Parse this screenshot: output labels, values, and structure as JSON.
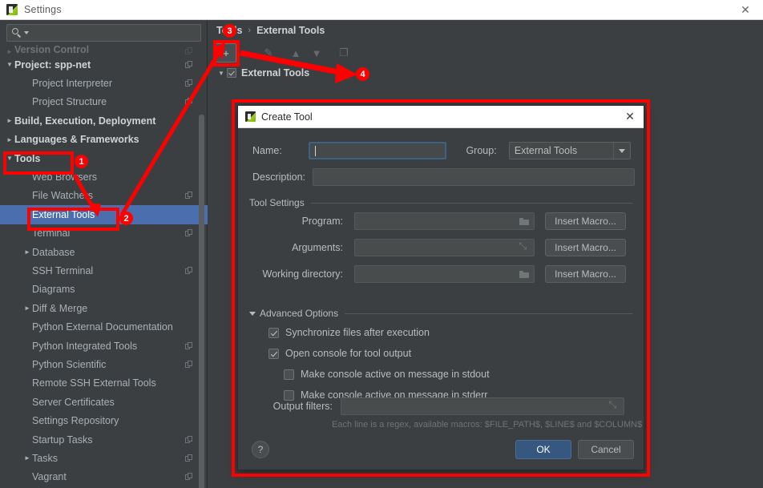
{
  "window": {
    "title": "Settings",
    "app_icon": "pycharm-icon",
    "close_label": "✕"
  },
  "search": {
    "value": "",
    "placeholder": "",
    "icon": "search-icon"
  },
  "sidebar": {
    "scrollbar": true,
    "items": [
      {
        "label": "Version Control",
        "indent": 0,
        "arrow": "right",
        "bold": true,
        "copy": true,
        "partial": true,
        "selected": false
      },
      {
        "label": "Project: spp-net",
        "indent": 0,
        "arrow": "down",
        "bold": true,
        "copy": true,
        "partial": false,
        "selected": false
      },
      {
        "label": "Project Interpreter",
        "indent": 1,
        "arrow": "",
        "bold": false,
        "copy": true,
        "partial": false,
        "selected": false
      },
      {
        "label": "Project Structure",
        "indent": 1,
        "arrow": "",
        "bold": false,
        "copy": true,
        "partial": false,
        "selected": false
      },
      {
        "label": "Build, Execution, Deployment",
        "indent": 0,
        "arrow": "right",
        "bold": true,
        "copy": false,
        "partial": false,
        "selected": false
      },
      {
        "label": "Languages & Frameworks",
        "indent": 0,
        "arrow": "right",
        "bold": true,
        "copy": false,
        "partial": false,
        "selected": false
      },
      {
        "label": "Tools",
        "indent": 0,
        "arrow": "down",
        "bold": true,
        "copy": false,
        "partial": false,
        "selected": false
      },
      {
        "label": "Web Browsers",
        "indent": 1,
        "arrow": "",
        "bold": false,
        "copy": false,
        "partial": false,
        "selected": false
      },
      {
        "label": "File Watchers",
        "indent": 1,
        "arrow": "",
        "bold": false,
        "copy": true,
        "partial": false,
        "selected": false
      },
      {
        "label": "External Tools",
        "indent": 1,
        "arrow": "",
        "bold": false,
        "copy": false,
        "partial": false,
        "selected": true
      },
      {
        "label": "Terminal",
        "indent": 1,
        "arrow": "",
        "bold": false,
        "copy": true,
        "partial": false,
        "selected": false
      },
      {
        "label": "Database",
        "indent": 1,
        "arrow": "right",
        "bold": false,
        "copy": false,
        "partial": false,
        "selected": false
      },
      {
        "label": "SSH Terminal",
        "indent": 1,
        "arrow": "",
        "bold": false,
        "copy": true,
        "partial": false,
        "selected": false
      },
      {
        "label": "Diagrams",
        "indent": 1,
        "arrow": "",
        "bold": false,
        "copy": false,
        "partial": false,
        "selected": false
      },
      {
        "label": "Diff & Merge",
        "indent": 1,
        "arrow": "right",
        "bold": false,
        "copy": false,
        "partial": false,
        "selected": false
      },
      {
        "label": "Python External Documentation",
        "indent": 1,
        "arrow": "",
        "bold": false,
        "copy": false,
        "partial": false,
        "selected": false
      },
      {
        "label": "Python Integrated Tools",
        "indent": 1,
        "arrow": "",
        "bold": false,
        "copy": true,
        "partial": false,
        "selected": false
      },
      {
        "label": "Python Scientific",
        "indent": 1,
        "arrow": "",
        "bold": false,
        "copy": true,
        "partial": false,
        "selected": false
      },
      {
        "label": "Remote SSH External Tools",
        "indent": 1,
        "arrow": "",
        "bold": false,
        "copy": false,
        "partial": false,
        "selected": false
      },
      {
        "label": "Server Certificates",
        "indent": 1,
        "arrow": "",
        "bold": false,
        "copy": false,
        "partial": false,
        "selected": false
      },
      {
        "label": "Settings Repository",
        "indent": 1,
        "arrow": "",
        "bold": false,
        "copy": false,
        "partial": false,
        "selected": false
      },
      {
        "label": "Startup Tasks",
        "indent": 1,
        "arrow": "",
        "bold": false,
        "copy": true,
        "partial": false,
        "selected": false
      },
      {
        "label": "Tasks",
        "indent": 1,
        "arrow": "right",
        "bold": false,
        "copy": true,
        "partial": false,
        "selected": false
      },
      {
        "label": "Vagrant",
        "indent": 1,
        "arrow": "",
        "bold": false,
        "copy": true,
        "partial": false,
        "selected": false
      }
    ]
  },
  "breadcrumb": {
    "parent": "Tools",
    "separator": "›",
    "current": "External Tools"
  },
  "toolbar": {
    "buttons": [
      {
        "name": "add-button",
        "glyph": "+",
        "state": "active"
      },
      {
        "name": "remove-button",
        "glyph": "−",
        "state": "dim"
      },
      {
        "name": "edit-button",
        "glyph": "✎",
        "state": "dim"
      },
      {
        "name": "move-up-button",
        "glyph": "▲",
        "state": "dim"
      },
      {
        "name": "move-down-button",
        "glyph": "▼",
        "state": "dim"
      },
      {
        "name": "copy-button",
        "glyph": "❐",
        "state": "dim"
      }
    ]
  },
  "tools_tree": {
    "root_label": "External Tools",
    "root_checked": true,
    "root_expanded": true
  },
  "dialog": {
    "title": "Create Tool",
    "icon": "pycharm-icon",
    "close_label": "✕",
    "name_label": "Name:",
    "name_value": "",
    "group_label": "Group:",
    "group_value": "External Tools",
    "description_label": "Description:",
    "description_value": "",
    "tool_settings_label": "Tool Settings",
    "program_label": "Program:",
    "program_value": "",
    "arguments_label": "Arguments:",
    "arguments_value": "",
    "working_dir_label": "Working directory:",
    "working_dir_value": "",
    "insert_macro_label": "Insert Macro...",
    "advanced_options_label": "Advanced Options",
    "checkboxes": [
      {
        "label": "Synchronize files after execution",
        "checked": true,
        "indent": 0
      },
      {
        "label": "Open console for tool output",
        "checked": true,
        "indent": 0
      },
      {
        "label": "Make console active on message in stdout",
        "checked": false,
        "indent": 1
      },
      {
        "label": "Make console active on message in stderr",
        "checked": false,
        "indent": 1
      }
    ],
    "output_filters_label": "Output filters:",
    "output_filters_value": "",
    "output_filters_hint": "Each line is a regex, available macros: $FILE_PATH$, $LINE$ and $COLUMN$",
    "help_label": "?",
    "ok_label": "OK",
    "cancel_label": "Cancel"
  },
  "annotations": {
    "accent_color": "#fe0000",
    "badges": [
      {
        "number": "1",
        "target": "tools-sidebar-item"
      },
      {
        "number": "2",
        "target": "external-tools-sidebar-item"
      },
      {
        "number": "3",
        "target": "add-toolbar-button"
      },
      {
        "number": "4",
        "target": "create-tool-dialog"
      }
    ]
  },
  "colors": {
    "background": "#3c3f41",
    "selection": "#4b6eaf",
    "field": "#45494a",
    "accent_red": "#fe0000",
    "ok_blue": "#365880",
    "text": "#bbbbbb",
    "titlebar": "#ffffff"
  }
}
